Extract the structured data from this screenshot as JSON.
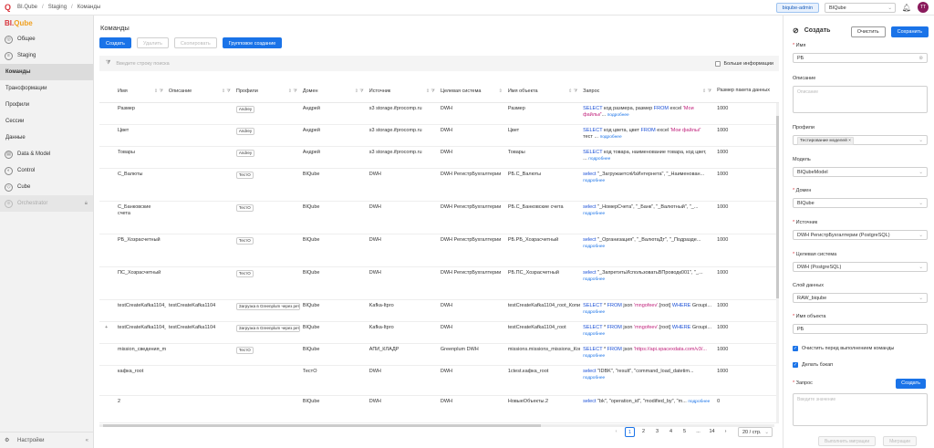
{
  "topbar": {
    "breadcrumb": [
      "BI.Qube",
      "Staging",
      "Команды"
    ],
    "user": "biqube-admin",
    "workspace": "BIQube",
    "avatar": "TT"
  },
  "sidebar": {
    "brand_a": "BI.",
    "brand_b": "Qube",
    "items": [
      {
        "label": "Общее",
        "icon": "globe-icon"
      },
      {
        "label": "Staging",
        "icon": "staging-icon"
      },
      {
        "label": "Команды"
      },
      {
        "label": "Трансформации"
      },
      {
        "label": "Профили"
      },
      {
        "label": "Сессии"
      },
      {
        "label": "Данные"
      },
      {
        "label": "Data & Model",
        "icon": "data-icon"
      },
      {
        "label": "Control",
        "icon": "control-icon"
      },
      {
        "label": "Cube",
        "icon": "cube-icon"
      },
      {
        "label": "Orchestrator",
        "icon": "orchestrator-icon"
      }
    ],
    "settings": "Настройки"
  },
  "main": {
    "title": "Команды",
    "buttons": {
      "create": "Создать",
      "delete": "Удалить",
      "copy": "Скопировать",
      "group": "Групповое создание"
    },
    "search_placeholder": "Введите строку поиска",
    "more_info": "Больше информации",
    "columns": [
      "Имя",
      "Описание",
      "Профили",
      "Домен",
      "Источник",
      "Целевая система",
      "Имя объекта",
      "Запрос",
      "Размер пакета данных"
    ],
    "more_label": "подробнее",
    "rows": [
      {
        "name": "Размер",
        "desc": "",
        "profile": "Andrey",
        "domain": "Андрей",
        "source": "s3 storage.ifprocomp.ru",
        "target": "DWH",
        "object": "Размер",
        "query": [
          [
            "kw",
            "SELECT"
          ],
          [
            "t",
            " код размера, размер "
          ],
          [
            "kw",
            "FROM"
          ],
          [
            "t",
            " excel "
          ],
          [
            "str",
            "'Мои файлы/'"
          ],
          [
            "t",
            "... "
          ]
        ],
        "size": "1000"
      },
      {
        "name": "Цвет",
        "desc": "",
        "profile": "Andrey",
        "domain": "Андрей",
        "source": "s3 storage.ifprocomp.ru",
        "target": "DWH",
        "object": "Цвет",
        "query": [
          [
            "kw",
            "SELECT"
          ],
          [
            "t",
            " код цвета, цвет "
          ],
          [
            "kw",
            "FROM"
          ],
          [
            "t",
            " excel "
          ],
          [
            "str",
            "'Мои файлы/'"
          ],
          [
            "t",
            " тест ... "
          ]
        ],
        "size": "1000"
      },
      {
        "name": "Товары",
        "desc": "",
        "profile": "Andrey",
        "domain": "Андрей",
        "source": "s3 storage.ifprocomp.ru",
        "target": "DWH",
        "object": "Товары",
        "query": [
          [
            "kw",
            "SELECT"
          ],
          [
            "t",
            " код товара, наименование товара, код цвет, ... "
          ]
        ],
        "size": "1000"
      },
      {
        "name": "С_Валюты",
        "desc": "",
        "profile": "ТестО",
        "domain": "BIQube",
        "source": "DWH",
        "target": "DWH РегистрБухгалтерии",
        "object": "РБ.С_Валюты",
        "query": [
          [
            "kw",
            "select"
          ],
          [
            "t",
            " \"_ЗагружаетсяИзИнтернета\", \"_Наименован... "
          ]
        ],
        "size": "1000"
      },
      {
        "name": "С_Банковские счета",
        "desc": "",
        "profile": "ТестО",
        "domain": "BIQube",
        "source": "DWH",
        "target": "DWH РегистрБухгалтерии",
        "object": "РБ.С_Банковские счета",
        "query": [
          [
            "kw",
            "select"
          ],
          [
            "t",
            " \"_НомерСчета\", \"_Банк\", \"_Валютный\", \"_... "
          ]
        ],
        "size": "1000"
      },
      {
        "name": "РБ_Хозрасчетный",
        "desc": "",
        "profile": "ТестО",
        "domain": "BIQube",
        "source": "DWH",
        "target": "DWH РегистрБухгалтерии",
        "object": "РБ.РБ_Хозрасчетный",
        "query": [
          [
            "kw",
            "select"
          ],
          [
            "t",
            " \"_Организация\", \"_ВалютаДт\", \"_Подразде... "
          ]
        ],
        "size": "1000"
      },
      {
        "name": "ПС_Хозрасчетный",
        "desc": "",
        "profile": "ТестО",
        "domain": "BIQube",
        "source": "DWH",
        "target": "DWH РегистрБухгалтерии",
        "object": "РБ.ПС_Хозрасчетный",
        "query": [
          [
            "kw",
            "select"
          ],
          [
            "t",
            " \"_ЗапретитьИспользоватьВПроводк001\", \"_... "
          ]
        ],
        "size": "1000"
      },
      {
        "name": "testCreateKafka1104_root_Копия",
        "desc": "testCreateKafka1104",
        "profile": "Загрузка в Greenplum через ретранслятор",
        "domain": "BIQube",
        "source": "Kafka-Itpro",
        "target": "DWH",
        "object": "testCreateKafka1104_root_Копия",
        "query": [
          [
            "kw",
            "SELECT"
          ],
          [
            "t",
            " * "
          ],
          [
            "kw",
            "FROM"
          ],
          [
            "t",
            " json "
          ],
          [
            "str",
            "'mngofeev'"
          ],
          [
            "t",
            ".[root] "
          ],
          [
            "kw",
            "WHERE"
          ],
          [
            "t",
            " Groupi... "
          ]
        ],
        "size": "1000"
      },
      {
        "name": "testCreateKafka1104_root",
        "desc": "testCreateKafka1104",
        "profile": "Загрузка в Greenplum через ретранслятор",
        "domain": "BIQube",
        "source": "Kafka-Itpro",
        "target": "DWH",
        "object": "testCreateKafka1104_root",
        "query": [
          [
            "kw",
            "SELECT"
          ],
          [
            "t",
            " * "
          ],
          [
            "kw",
            "FROM"
          ],
          [
            "t",
            " json "
          ],
          [
            "str",
            "'mngofeev'"
          ],
          [
            "t",
            ".[root] "
          ],
          [
            "kw",
            "WHERE"
          ],
          [
            "t",
            " Groupi... "
          ]
        ],
        "size": "1000"
      },
      {
        "name": "mission_сведения_missions_Копия",
        "desc": "",
        "profile": "ТестО",
        "domain": "BIQube",
        "source": "АПИ_КЛАДР",
        "target": "Greenplum DWH",
        "object": "missions.missions_missions_Копия",
        "query": [
          [
            "kw",
            "SELECT"
          ],
          [
            "t",
            " * "
          ],
          [
            "kw",
            "FROM"
          ],
          [
            "t",
            " json "
          ],
          [
            "str",
            "'https://api.spacexdata.com/v3/..."
          ]
        ],
        "size": "1000"
      },
      {
        "name": "кафка_root",
        "desc": "",
        "profile": "",
        "domain": "ТестО",
        "source": "DWH",
        "target": "DWH",
        "object": "1ctest.кафка_root",
        "query": [
          [
            "kw",
            "select"
          ],
          [
            "t",
            " \"IDBK\", \"result\", \"command_load_datetim... "
          ]
        ],
        "size": "1000"
      },
      {
        "name": "2",
        "desc": "",
        "profile": "",
        "domain": "BIQube",
        "source": "DWH",
        "target": "DWH",
        "object": "НовыеОбъекты.2",
        "query": [
          [
            "kw",
            "select"
          ],
          [
            "t",
            " \"bk\", \"operation_id\", \"modified_by\", \"m... "
          ]
        ],
        "size": "0"
      }
    ],
    "pagination": {
      "pages": [
        "1",
        "2",
        "3",
        "4",
        "5",
        "...",
        "14"
      ],
      "current": "1",
      "page_size": "20 / стр."
    }
  },
  "panel": {
    "title": "Создать",
    "clear": "Очистить",
    "save": "Сохранить",
    "name_label": "Имя",
    "name_value": "РБ",
    "desc_label": "Описание",
    "desc_placeholder": "Описание",
    "profiles_label": "Профили",
    "profiles_value": "Тестирование моделей",
    "model_label": "Модель",
    "model_value": "BIQubeModel",
    "domain_label": "Домен",
    "domain_value": "BIQube",
    "source_label": "Источник",
    "source_value": "DWH РегистрБухгалтерии (PostgreSQL)",
    "target_label": "Целевая система",
    "target_value": "DWH (PostgreSQL)",
    "layer_label": "Слой данных",
    "layer_value": "RAW_biqube",
    "object_label": "Имя объекта",
    "object_value": "РБ",
    "clean_label": "Очистить перед выполнением команды",
    "backup_label": "Делать бэкап",
    "query_label": "Запрос",
    "query_create": "Создать",
    "query_placeholder": "Введите значение",
    "run_migrations": "Выполнить миграции",
    "migrations": "Миграции"
  }
}
